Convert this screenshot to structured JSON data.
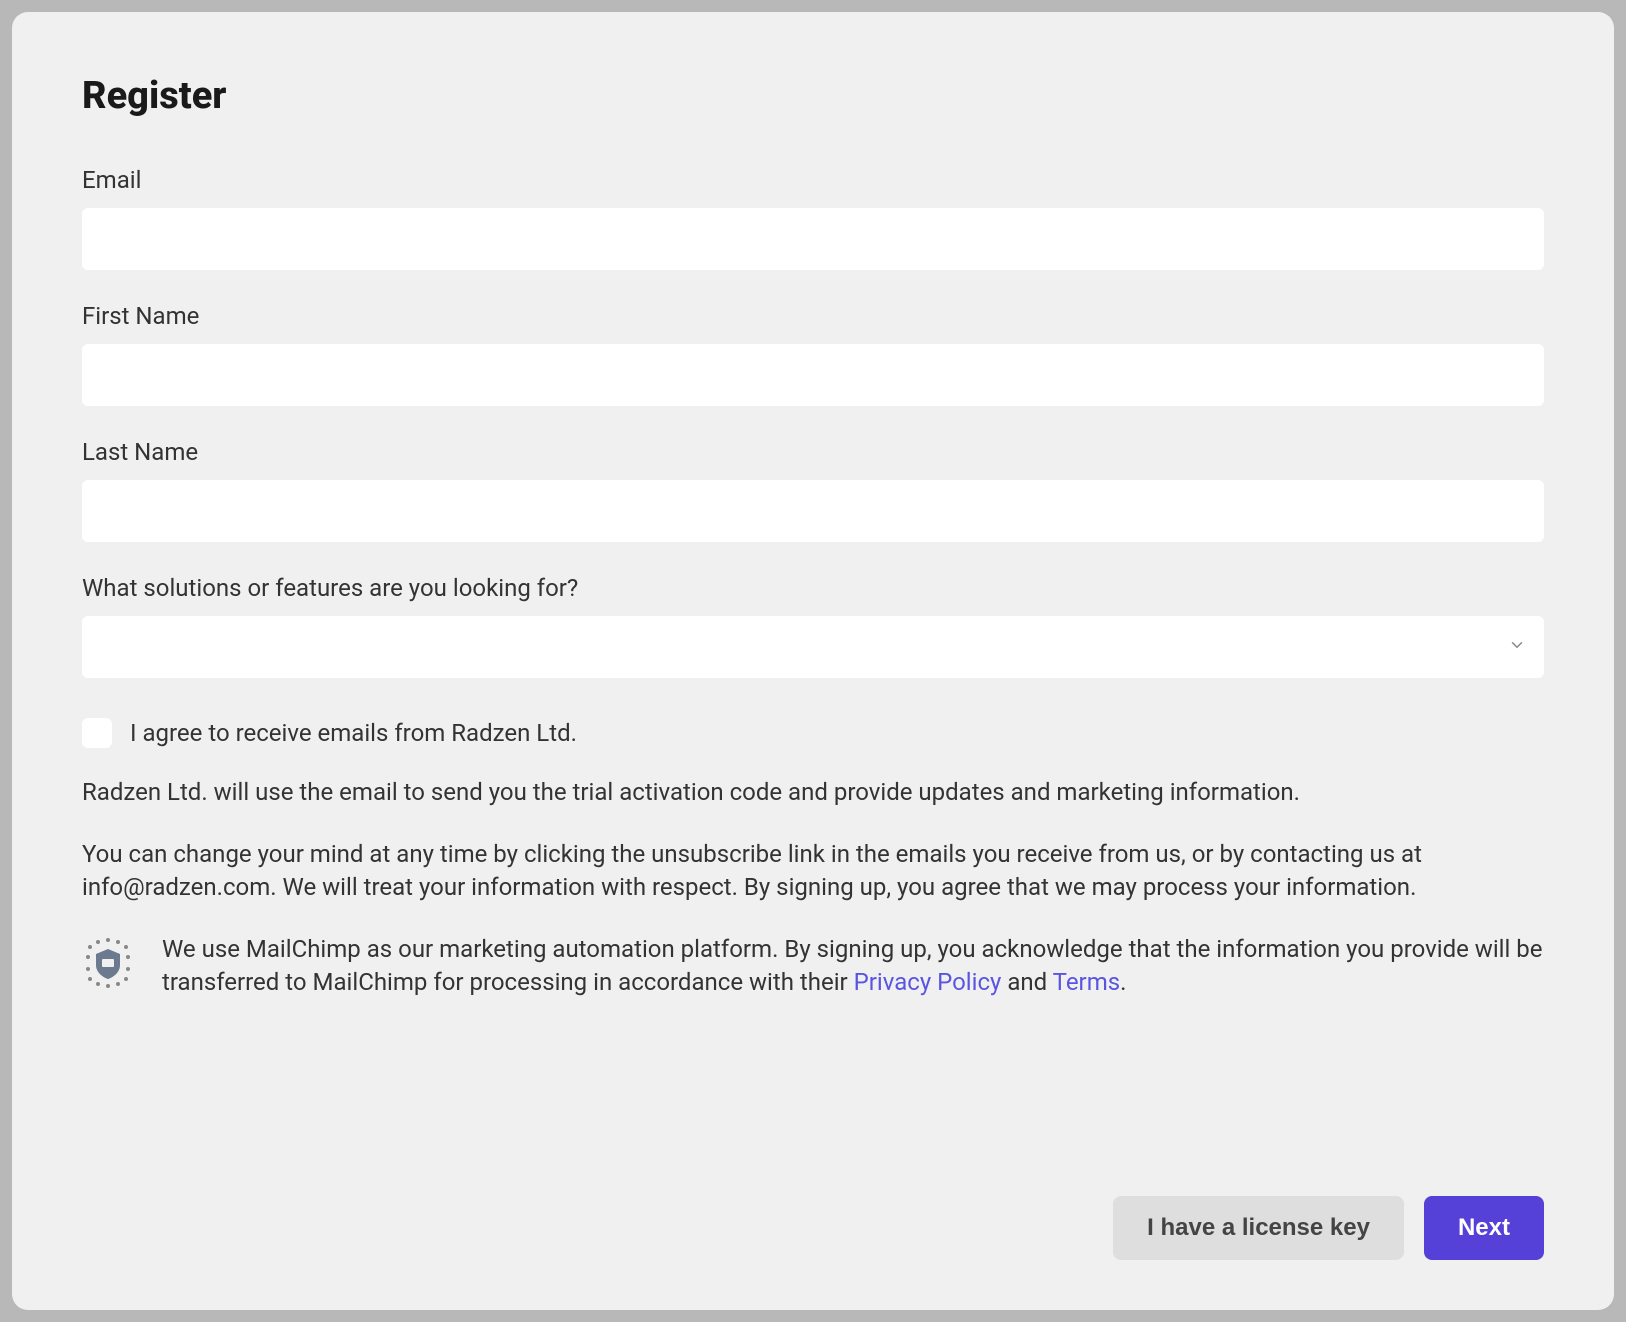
{
  "title": "Register",
  "fields": {
    "email": {
      "label": "Email",
      "value": ""
    },
    "firstName": {
      "label": "First Name",
      "value": ""
    },
    "lastName": {
      "label": "Last Name",
      "value": ""
    },
    "solutions": {
      "label": "What solutions or features are you looking for?",
      "value": ""
    }
  },
  "consent": {
    "checkboxLabel": "I agree to receive emails from Radzen Ltd.",
    "checked": false,
    "usageText": "Radzen Ltd. will use the email to send you the trial activation code and provide updates and marketing information.",
    "unsubscribeText": "You can change your mind at any time by clicking the unsubscribe link in the emails you receive from us, or by contacting us at info@radzen.com. We will treat your information with respect. By signing up, you agree that we may process your information.",
    "mailchimpPrefix": "We use MailChimp as our marketing automation platform. By signing up, you acknowledge that the information you provide will be transferred to MailChimp for processing in accordance with their ",
    "privacyLabel": "Privacy Policy",
    "and": " and ",
    "termsLabel": "Terms",
    "suffix": "."
  },
  "buttons": {
    "licenseKey": "I have a license key",
    "next": "Next"
  }
}
